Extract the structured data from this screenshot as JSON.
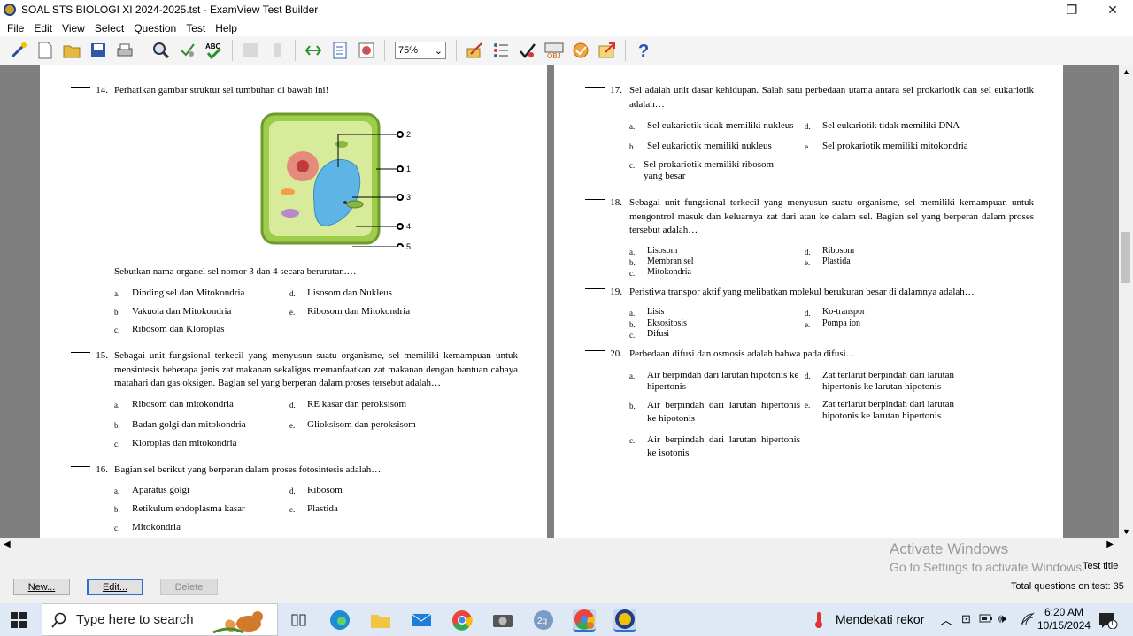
{
  "window": {
    "title": "SOAL STS BIOLOGI XI 2024-2025.tst - ExamView Test Builder",
    "minimize": "—",
    "restore": "❐",
    "close": "✕"
  },
  "menu": [
    "File",
    "Edit",
    "View",
    "Select",
    "Question",
    "Test",
    "Help"
  ],
  "toolbar": {
    "zoom": "75%"
  },
  "left_page": {
    "q14": {
      "num": "14.",
      "text": "Perhatikan gambar struktur sel tumbuhan di bawah ini!",
      "followup": "Sebutkan nama organel sel nomor 3 dan 4 secara berurutan.…",
      "labels": [
        "2",
        "1",
        "3",
        "4",
        "5"
      ],
      "options": [
        {
          "l": "a.",
          "t": "Dinding sel dan Mitokondria"
        },
        {
          "l": "d.",
          "t": "Lisosom dan Nukleus"
        },
        {
          "l": "b.",
          "t": "Vakuola dan Mitokondria"
        },
        {
          "l": "e.",
          "t": "Ribosom dan Mitokondria"
        },
        {
          "l": "c.",
          "t": "Ribosom dan Kloroplas"
        }
      ]
    },
    "q15": {
      "num": "15.",
      "text": "Sebagai unit fungsional terkecil yang menyusun suatu organisme, sel memiliki kemampuan untuk mensintesis beberapa jenis zat makanan sekaligus memanfaatkan zat makanan dengan bantuan cahaya matahari dan gas oksigen. Bagian sel yang berperan dalam proses tersebut adalah…",
      "options": [
        {
          "l": "a.",
          "t": "Ribosom dan mitokondria"
        },
        {
          "l": "d.",
          "t": "RE kasar dan peroksisom"
        },
        {
          "l": "b.",
          "t": "Badan golgi dan mitokondria"
        },
        {
          "l": "e.",
          "t": "Glioksisom dan peroksisom"
        },
        {
          "l": "c.",
          "t": "Kloroplas dan mitokondria"
        }
      ]
    },
    "q16": {
      "num": "16.",
      "text": "Bagian sel berikut yang berperan dalam proses fotosintesis adalah…",
      "options": [
        {
          "l": "a.",
          "t": "Aparatus golgi"
        },
        {
          "l": "d.",
          "t": "Ribosom"
        },
        {
          "l": "b.",
          "t": "Retikulum endoplasma kasar"
        },
        {
          "l": "e.",
          "t": "Plastida"
        },
        {
          "l": "c.",
          "t": "Mitokondria"
        }
      ]
    }
  },
  "right_page": {
    "q17": {
      "num": "17.",
      "text": "Sel adalah unit dasar kehidupan. Salah satu perbedaan utama antara sel prokariotik dan sel eukariotik adalah…",
      "options": [
        {
          "l": "a.",
          "t": "Sel eukariotik tidak memiliki nukleus"
        },
        {
          "l": "d.",
          "t": "Sel eukariotik tidak memiliki DNA"
        },
        {
          "l": "b.",
          "t": "Sel eukariotik memiliki nukleus"
        },
        {
          "l": "e.",
          "t": "Sel prokariotik memiliki mitokondria"
        },
        {
          "l": "c.",
          "t": "Sel prokariotik memiliki ribosom yang besar"
        }
      ]
    },
    "q18": {
      "num": "18.",
      "text": "Sebagai unit fungsional terkecil yang menyusun suatu organisme, sel memiliki kemampuan untuk mengontrol masuk dan keluarnya zat dari atau ke dalam sel. Bagian sel yang berperan dalam proses tersebut adalah…",
      "options": [
        {
          "l": "a.",
          "t": "Lisosom"
        },
        {
          "l": "d.",
          "t": "Ribosom"
        },
        {
          "l": "b.",
          "t": "Membran sel"
        },
        {
          "l": "e.",
          "t": "Plastida"
        },
        {
          "l": "c.",
          "t": "Mitokondria"
        }
      ]
    },
    "q19": {
      "num": "19.",
      "text": "Peristiwa transpor aktif yang melibatkan molekul berukuran besar di dalamnya adalah…",
      "options": [
        {
          "l": "a.",
          "t": "Lisis"
        },
        {
          "l": "d.",
          "t": "Ko-transpor"
        },
        {
          "l": "b.",
          "t": "Eksositosis"
        },
        {
          "l": "e.",
          "t": "Pompa ion"
        },
        {
          "l": "c.",
          "t": "Difusi"
        }
      ]
    },
    "q20": {
      "num": "20.",
      "text": "Perbedaan difusi dan osmosis adalah bahwa pada difusi…",
      "options": [
        {
          "l": "a.",
          "t": "Air berpindah dari larutan hipotonis ke hipertonis"
        },
        {
          "l": "d.",
          "t": "Zat terlarut berpindah dari larutan hipertonis ke larutan hipotonis"
        },
        {
          "l": "b.",
          "t": "Air berpindah dari larutan hipertonis ke hipotonis"
        },
        {
          "l": "e.",
          "t": "Zat terlarut berpindah dari larutan hipotonis ke larutan hipertonis"
        },
        {
          "l": "c.",
          "t": "Air berpindah dari larutan hipertonis ke isotonis"
        }
      ]
    }
  },
  "bottom": {
    "new": "New...",
    "edit": "Edit...",
    "delete": "Delete",
    "test_title": "Test title",
    "total": "Total questions on test: 35",
    "activate_line1": "Activate Windows",
    "activate_line2": "Go to Settings to activate Windows."
  },
  "taskbar": {
    "search_placeholder": "Type here to search",
    "weather": "Mendekati rekor",
    "time": "6:20 AM",
    "date": "10/15/2024",
    "notif_count": "1"
  },
  "colors": {
    "toolbar_bg": "#f4f4f4",
    "workspace": "#7f7f7f",
    "taskbar": "#dfe9f6"
  }
}
